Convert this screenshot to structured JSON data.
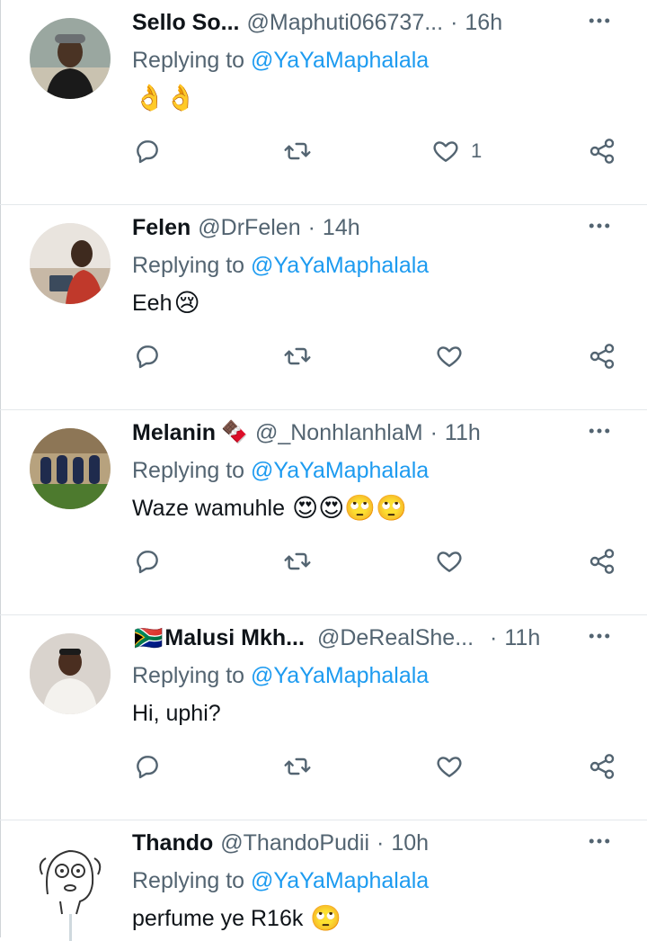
{
  "theme": {
    "text": "#0f1419",
    "secondary": "#536471",
    "accent": "#1d9bf0",
    "divider": "#e4e8eb"
  },
  "tweets": [
    {
      "name": "Sello So...",
      "handle": "@Maphuti066737...",
      "separator": "·",
      "time": "16h",
      "replying_prefix": "Replying to",
      "replying_to": "@YaYaMaphalala",
      "text": "",
      "emojis": "👌👌",
      "like_count": "1",
      "avatar_icon": "person-avatar"
    },
    {
      "name": "Felen",
      "handle": "@DrFelen",
      "separator": "·",
      "time": "14h",
      "replying_prefix": "Replying to",
      "replying_to": "@YaYaMaphalala",
      "text": "Eeh",
      "emojis": "😢",
      "like_count": "",
      "avatar_icon": "person-avatar"
    },
    {
      "name": "Melanin",
      "name_emoji": "🍫",
      "handle": "@_NonhlanhlaM",
      "separator": "·",
      "time": "11h",
      "replying_prefix": "Replying to",
      "replying_to": "@YaYaMaphalala",
      "text": "Waze wamuhle",
      "emojis": "😍😍🙄🙄",
      "like_count": "",
      "avatar_icon": "group-photo-avatar"
    },
    {
      "name_flag": "🇿🇦",
      "name": "Malusi Mkh...",
      "handle": "@DeRealShe...",
      "separator": "·",
      "time": "11h",
      "replying_prefix": "Replying to",
      "replying_to": "@YaYaMaphalala",
      "text": "Hi, uphi?",
      "emojis": "",
      "like_count": "",
      "avatar_icon": "person-avatar"
    },
    {
      "name": "Thando",
      "handle": "@ThandoPudii",
      "separator": "·",
      "time": "10h",
      "replying_prefix": "Replying to",
      "replying_to": "@YaYaMaphalala",
      "text": "perfume ye R16k",
      "emojis": "🙄",
      "like_count": "",
      "avatar_icon": "cartoon-face-avatar"
    }
  ]
}
